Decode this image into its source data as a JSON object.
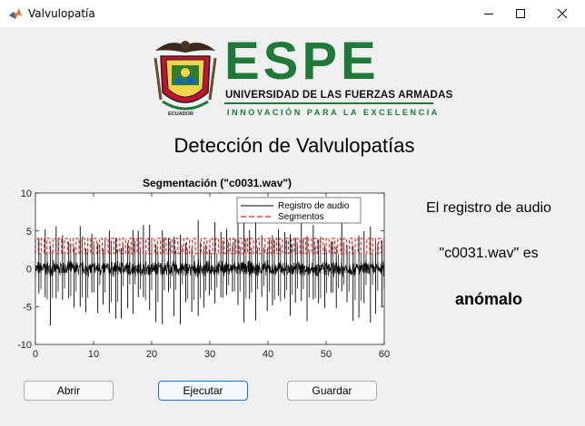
{
  "window": {
    "title": "Valvulopatía",
    "icon": "matlab-icon",
    "controls": [
      "minimize-icon",
      "maximize-icon",
      "close-icon"
    ]
  },
  "logo": {
    "word": "ESPE",
    "university": "UNIVERSIDAD DE LAS FUERZAS ARMADAS",
    "slogan": "INNOVACIÓN PARA LA EXCELENCIA",
    "seal_text": "ECUADOR"
  },
  "header": {
    "title": "Detección de Valvulopatías"
  },
  "chart_data": {
    "type": "line",
    "title": "Segmentación (\"c0031.wav\")",
    "xlabel": "",
    "ylabel": "",
    "xlim": [
      0,
      60
    ],
    "ylim": [
      -10,
      10
    ],
    "xticks": [
      0,
      10,
      20,
      30,
      40,
      50,
      60
    ],
    "yticks": [
      -10,
      -5,
      0,
      5,
      10
    ],
    "grid": false,
    "legend_position": "top-right",
    "series": [
      {
        "name": "Registro de audio",
        "color": "#000000",
        "style": "solid",
        "description_values": {
          "baseline_amplitude": 1.2,
          "peak_max": 6.5,
          "peak_min": -7.5,
          "beat_interval": 1.0,
          "first_beat": 0.6
        }
      },
      {
        "name": "Segmentos",
        "color": "#d62728",
        "style": "dashed",
        "description_values": {
          "high": 4,
          "low": 2,
          "period": 1.0
        }
      }
    ]
  },
  "result": {
    "line1": "El registro de audio",
    "line2": "\"c0031.wav\" es",
    "verdict": "anómalo"
  },
  "buttons": {
    "open": "Abrir",
    "run": "Ejecutar",
    "save": "Guardar"
  },
  "colors": {
    "brand_green": "#1f7a3a",
    "focus_blue": "#1f6fd1",
    "segment_red": "#d62728"
  }
}
